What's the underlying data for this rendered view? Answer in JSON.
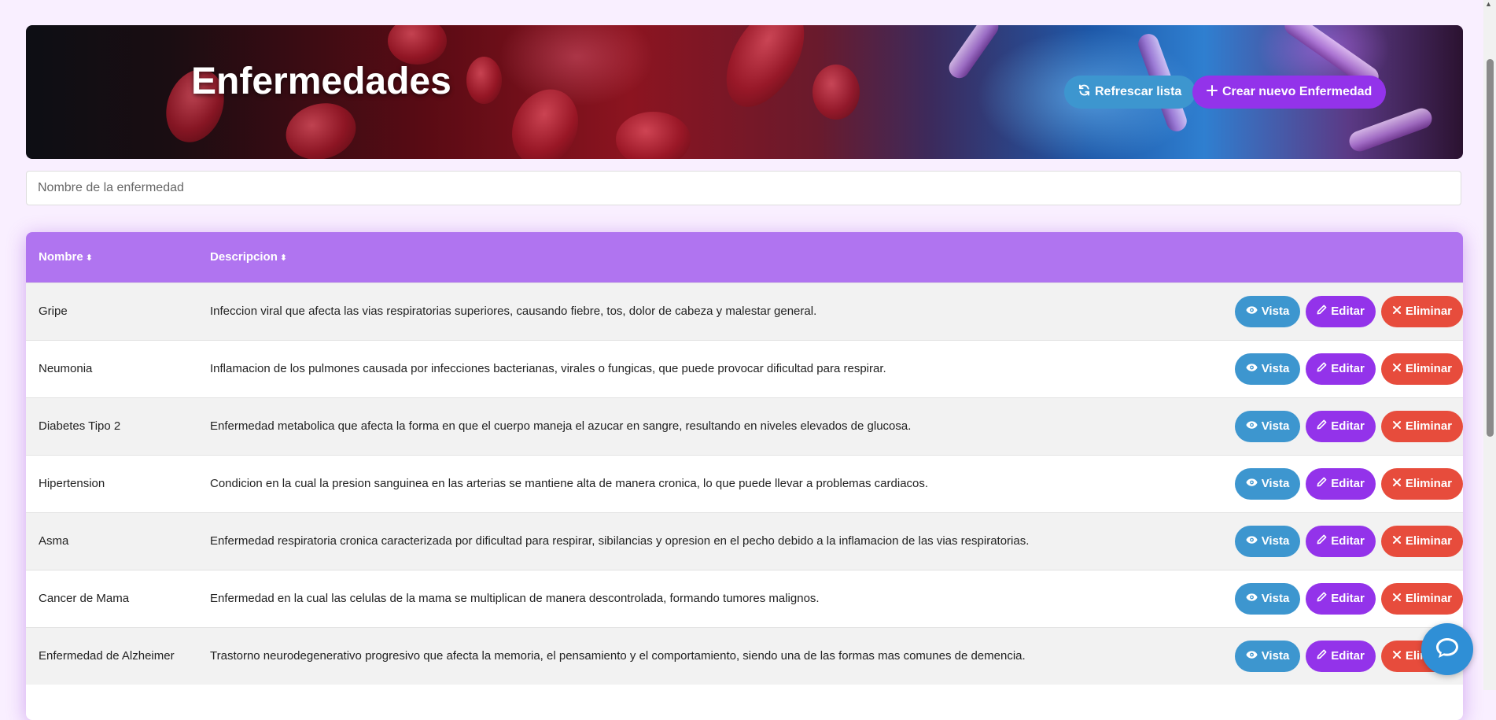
{
  "header": {
    "title": "Enfermedades",
    "refresh_label": "Refrescar lista",
    "create_label": "Crear nuevo Enfermedad"
  },
  "search": {
    "placeholder": "Nombre de la enfermedad",
    "value": ""
  },
  "table": {
    "columns": [
      "Nombre",
      "Descripcion"
    ],
    "actions": {
      "view": "Vista",
      "edit": "Editar",
      "delete": "Eliminar"
    },
    "rows": [
      {
        "name": "Gripe",
        "description": "Infeccion viral que afecta las vias respiratorias superiores, causando fiebre, tos, dolor de cabeza y malestar general."
      },
      {
        "name": "Neumonia",
        "description": "Inflamacion de los pulmones causada por infecciones bacterianas, virales o fungicas, que puede provocar dificultad para respirar."
      },
      {
        "name": "Diabetes Tipo 2",
        "description": "Enfermedad metabolica que afecta la forma en que el cuerpo maneja el azucar en sangre, resultando en niveles elevados de glucosa."
      },
      {
        "name": "Hipertension",
        "description": "Condicion en la cual la presion sanguinea en las arterias se mantiene alta de manera cronica, lo que puede llevar a problemas cardiacos."
      },
      {
        "name": "Asma",
        "description": "Enfermedad respiratoria cronica caracterizada por dificultad para respirar, sibilancias y opresion en el pecho debido a la inflamacion de las vias respiratorias."
      },
      {
        "name": "Cancer de Mama",
        "description": "Enfermedad en la cual las celulas de la mama se multiplican de manera descontrolada, formando tumores malignos."
      },
      {
        "name": "Enfermedad de Alzheimer",
        "description": "Trastorno neurodegenerativo progresivo que afecta la memoria, el pensamiento y el comportamiento, siendo una de las formas mas comunes de demencia."
      }
    ]
  },
  "colors": {
    "page_bg": "#f9efff",
    "table_header": "#b074f0",
    "view_button": "#3d96cf",
    "edit_button": "#9333ea",
    "delete_button": "#e74c3c",
    "create_button": "#9333ea",
    "refresh_button": "#3d96cf",
    "chat_button": "#2f8fd6"
  },
  "icons": {
    "refresh": "refresh-icon",
    "create": "plus-icon",
    "sort": "sort-icon",
    "view": "eye-icon",
    "edit": "pencil-icon",
    "delete": "x-icon",
    "chat": "chat-icon"
  }
}
